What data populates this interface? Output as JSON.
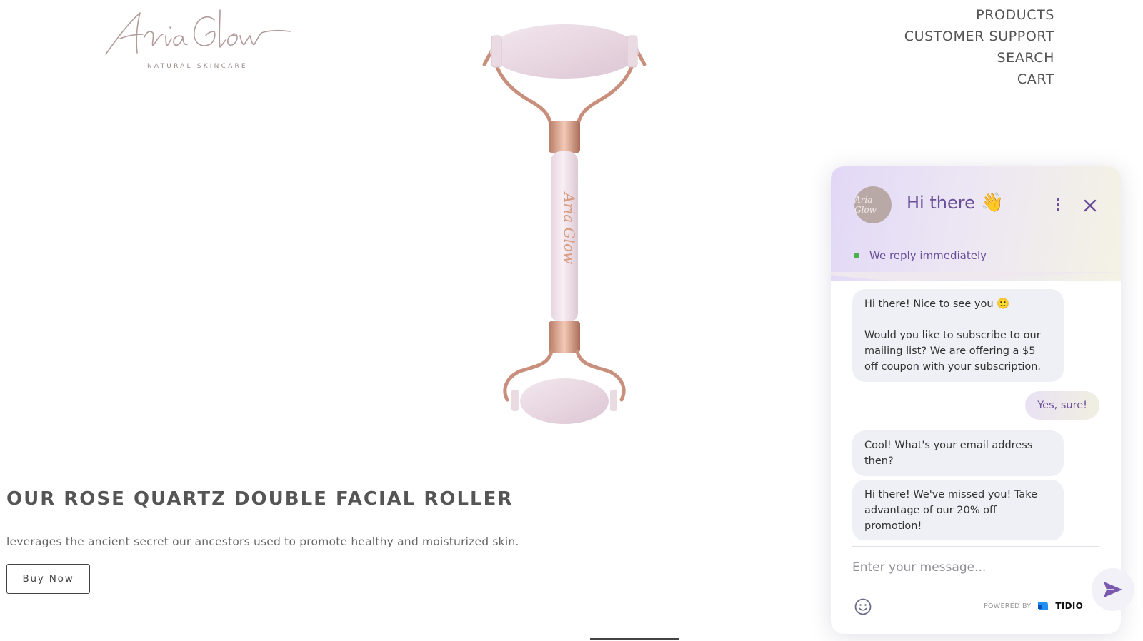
{
  "brand": {
    "logo_text": "Aria Glow",
    "tagline": "NATURAL SKINCARE"
  },
  "nav": {
    "items": [
      {
        "label": "PRODUCTS"
      },
      {
        "label": "CUSTOMER SUPPORT"
      },
      {
        "label": "SEARCH"
      },
      {
        "label": "CART"
      }
    ]
  },
  "product": {
    "engraving": "Aria Glow"
  },
  "hero": {
    "title": "OUR ROSE QUARTZ DOUBLE FACIAL ROLLER",
    "description": "leverages the ancient secret our ancestors used to promote healthy and moisturized skin.",
    "cta_label": "Buy Now"
  },
  "chat": {
    "avatar_text": "Aria Glow",
    "title": "Hi there",
    "title_emoji": "👋",
    "status": "We reply immediately",
    "status_color": "#4caf50",
    "accent": "#6a4e9a",
    "messages": [
      {
        "from": "bot",
        "lines": [
          "Hi there! Nice to see you 🙂",
          "Would you like to subscribe to our mailing list? We are offering a $5 off coupon with your subscription."
        ]
      },
      {
        "from": "user",
        "text": "Yes, sure!"
      },
      {
        "from": "bot",
        "text": "Cool! What's your email address then?"
      },
      {
        "from": "bot",
        "text": "Hi there! We've missed you! Take advantage of our 20% off promotion!"
      }
    ],
    "input_placeholder": "Enter your message...",
    "powered_by": "POWERED BY",
    "provider": "TIDIO",
    "icons": {
      "menu": "more-vertical-icon",
      "close": "close-icon",
      "send": "send-icon",
      "emoji": "emoji-icon"
    }
  }
}
